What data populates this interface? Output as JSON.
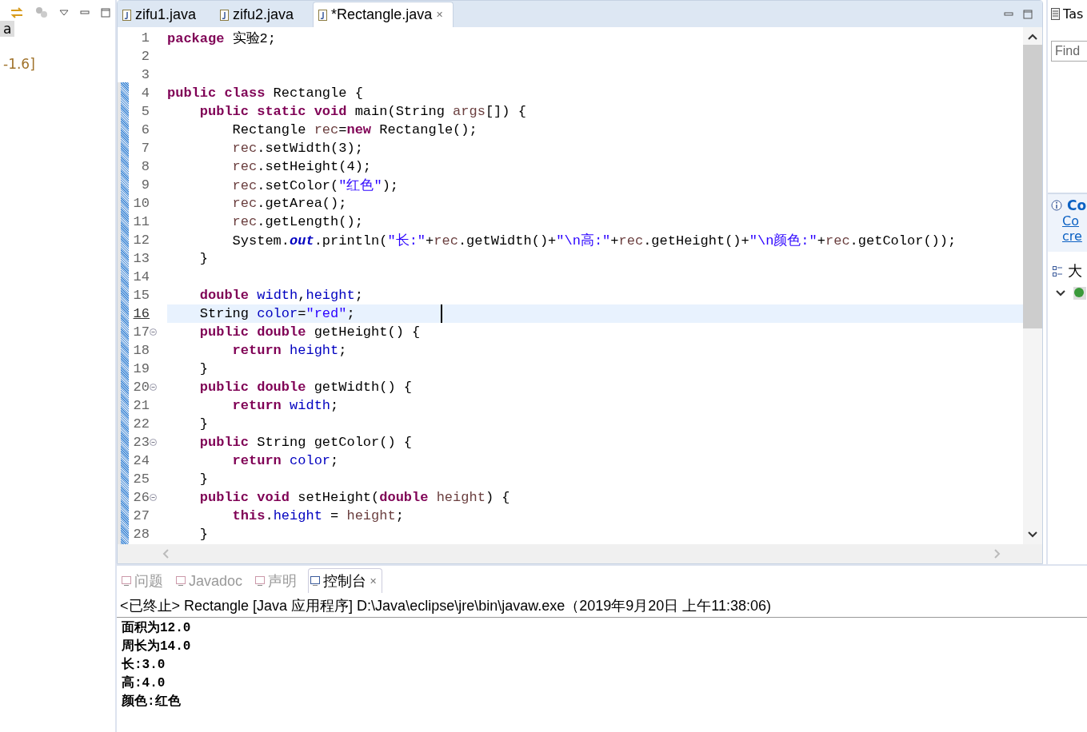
{
  "left_panel": {
    "tree_items": [
      {
        "label": "a",
        "selected": true
      },
      {
        "label": "-1.6]",
        "selected": false
      }
    ]
  },
  "editor": {
    "tabs": [
      {
        "label": "zifu1.java",
        "selected": false
      },
      {
        "label": "zifu2.java",
        "selected": false
      },
      {
        "label": "*Rectangle.java",
        "selected": true,
        "close": "✕"
      }
    ],
    "lines": [
      {
        "number": "1",
        "foldable": false,
        "current": false,
        "tokens": [
          {
            "kind": "kw",
            "text": "package"
          },
          {
            "kind": "plain",
            "text": " 实验2;"
          }
        ]
      },
      {
        "number": "2",
        "foldable": false,
        "current": false
      },
      {
        "number": "3",
        "foldable": false,
        "current": false
      },
      {
        "number": "4",
        "foldable": false,
        "current": false,
        "tokens": [
          {
            "kind": "kw",
            "text": "public class"
          },
          {
            "kind": "plain",
            "text": " Rectangle {"
          }
        ]
      },
      {
        "number": "5",
        "foldable": false,
        "current": false,
        "tokens": [
          {
            "kind": "kw",
            "text": "    public static void"
          },
          {
            "kind": "plain",
            "text": " main(String "
          },
          {
            "kind": "local",
            "text": "args"
          },
          {
            "kind": "plain",
            "text": "[]) {"
          }
        ]
      },
      {
        "number": "6",
        "foldable": false,
        "current": false,
        "tokens": [
          {
            "kind": "plain",
            "text": "        Rectangle "
          },
          {
            "kind": "local",
            "text": "rec"
          },
          {
            "kind": "plain",
            "text": "="
          },
          {
            "kind": "kw",
            "text": "new"
          },
          {
            "kind": "plain",
            "text": " Rectangle();"
          }
        ]
      },
      {
        "number": "7",
        "foldable": false,
        "current": false,
        "tokens": [
          {
            "kind": "local",
            "text": "        rec"
          },
          {
            "kind": "plain",
            "text": ".setWidth(3);"
          }
        ]
      },
      {
        "number": "8",
        "foldable": false,
        "current": false,
        "tokens": [
          {
            "kind": "local",
            "text": "        rec"
          },
          {
            "kind": "plain",
            "text": ".setHeight(4);"
          }
        ]
      },
      {
        "number": "9",
        "foldable": false,
        "current": false,
        "tokens": [
          {
            "kind": "local",
            "text": "        rec"
          },
          {
            "kind": "plain",
            "text": ".setColor("
          },
          {
            "kind": "str",
            "text": "\"红色\""
          },
          {
            "kind": "plain",
            "text": ");"
          }
        ]
      },
      {
        "number": "10",
        "foldable": false,
        "current": false,
        "tokens": [
          {
            "kind": "local",
            "text": "        rec"
          },
          {
            "kind": "plain",
            "text": ".getArea();"
          }
        ]
      },
      {
        "number": "11",
        "foldable": false,
        "current": false,
        "tokens": [
          {
            "kind": "local",
            "text": "        rec"
          },
          {
            "kind": "plain",
            "text": ".getLength();"
          }
        ]
      },
      {
        "number": "12",
        "foldable": false,
        "current": false,
        "tokens": [
          {
            "kind": "plain",
            "text": "        System."
          },
          {
            "kind": "static",
            "text": "out"
          },
          {
            "kind": "plain",
            "text": ".println("
          },
          {
            "kind": "str",
            "text": "\"长:\""
          },
          {
            "kind": "plain",
            "text": "+"
          },
          {
            "kind": "local",
            "text": "rec"
          },
          {
            "kind": "plain",
            "text": ".getWidth()+"
          },
          {
            "kind": "str",
            "text": "\"\\n高:\""
          },
          {
            "kind": "plain",
            "text": "+"
          },
          {
            "kind": "local",
            "text": "rec"
          },
          {
            "kind": "plain",
            "text": ".getHeight()+"
          },
          {
            "kind": "str",
            "text": "\"\\n颜色:\""
          },
          {
            "kind": "plain",
            "text": "+"
          },
          {
            "kind": "local",
            "text": "rec"
          },
          {
            "kind": "plain",
            "text": ".getColor());"
          }
        ]
      },
      {
        "number": "13",
        "foldable": false,
        "current": false,
        "tokens": [
          {
            "kind": "plain",
            "text": "    }"
          }
        ]
      },
      {
        "number": "14",
        "foldable": false,
        "current": false
      },
      {
        "number": "15",
        "foldable": false,
        "current": false,
        "tokens": [
          {
            "kind": "kw",
            "text": "    double"
          },
          {
            "kind": "field",
            "text": " width"
          },
          {
            "kind": "plain",
            "text": ","
          },
          {
            "kind": "field",
            "text": "height"
          },
          {
            "kind": "plain",
            "text": ";"
          }
        ]
      },
      {
        "number": "16",
        "foldable": false,
        "current": true,
        "tokens": [
          {
            "kind": "plain",
            "text": "    String "
          },
          {
            "kind": "field",
            "text": "color"
          },
          {
            "kind": "plain",
            "text": "="
          },
          {
            "kind": "str",
            "text": "\"red\""
          },
          {
            "kind": "plain",
            "text": ";"
          }
        ]
      },
      {
        "number": "17",
        "foldable": true,
        "current": false,
        "tokens": [
          {
            "kind": "kw",
            "text": "    public double"
          },
          {
            "kind": "plain",
            "text": " getHeight() {"
          }
        ]
      },
      {
        "number": "18",
        "foldable": false,
        "current": false,
        "tokens": [
          {
            "kind": "kw",
            "text": "        return"
          },
          {
            "kind": "field",
            "text": " height"
          },
          {
            "kind": "plain",
            "text": ";"
          }
        ]
      },
      {
        "number": "19",
        "foldable": false,
        "current": false,
        "tokens": [
          {
            "kind": "plain",
            "text": "    }"
          }
        ]
      },
      {
        "number": "20",
        "foldable": true,
        "current": false,
        "tokens": [
          {
            "kind": "kw",
            "text": "    public double"
          },
          {
            "kind": "plain",
            "text": " getWidth() {"
          }
        ]
      },
      {
        "number": "21",
        "foldable": false,
        "current": false,
        "tokens": [
          {
            "kind": "kw",
            "text": "        return"
          },
          {
            "kind": "field",
            "text": " width"
          },
          {
            "kind": "plain",
            "text": ";"
          }
        ]
      },
      {
        "number": "22",
        "foldable": false,
        "current": false,
        "tokens": [
          {
            "kind": "plain",
            "text": "    }"
          }
        ]
      },
      {
        "number": "23",
        "foldable": true,
        "current": false,
        "tokens": [
          {
            "kind": "kw",
            "text": "    public"
          },
          {
            "kind": "plain",
            "text": " String getColor() {"
          }
        ]
      },
      {
        "number": "24",
        "foldable": false,
        "current": false,
        "tokens": [
          {
            "kind": "kw",
            "text": "        return"
          },
          {
            "kind": "field",
            "text": " color"
          },
          {
            "kind": "plain",
            "text": ";"
          }
        ]
      },
      {
        "number": "25",
        "foldable": false,
        "current": false,
        "tokens": [
          {
            "kind": "plain",
            "text": "    }"
          }
        ]
      },
      {
        "number": "26",
        "foldable": true,
        "current": false,
        "tokens": [
          {
            "kind": "kw",
            "text": "    public void"
          },
          {
            "kind": "plain",
            "text": " setHeight("
          },
          {
            "kind": "kw",
            "text": "double"
          },
          {
            "kind": "local",
            "text": " height"
          },
          {
            "kind": "plain",
            "text": ") {"
          }
        ]
      },
      {
        "number": "27",
        "foldable": false,
        "current": false,
        "tokens": [
          {
            "kind": "kw",
            "text": "        this"
          },
          {
            "kind": "plain",
            "text": "."
          },
          {
            "kind": "field",
            "text": "height"
          },
          {
            "kind": "plain",
            "text": " = "
          },
          {
            "kind": "local",
            "text": "height"
          },
          {
            "kind": "plain",
            "text": ";"
          }
        ]
      },
      {
        "number": "28",
        "foldable": false,
        "current": false,
        "tokens": [
          {
            "kind": "plain",
            "text": "    }"
          }
        ]
      }
    ]
  },
  "right_panel": {
    "task_tab": "Tas",
    "find_field": {
      "placeholder": "Find"
    },
    "info": {
      "title": "Co",
      "links": [
        "Co",
        "cre"
      ]
    },
    "outline_tab": "大"
  },
  "console": {
    "tabs": [
      {
        "label": "问题",
        "selected": false
      },
      {
        "label": "Javadoc",
        "selected": false
      },
      {
        "label": "声明",
        "selected": false
      },
      {
        "label": "控制台",
        "selected": true,
        "close": "✕"
      }
    ],
    "header": "<已终止> Rectangle [Java 应用程序] D:\\Java\\eclipse\\jre\\bin\\javaw.exe（2019年9月20日 上午11:38:06)",
    "output": [
      "面积为12.0",
      "周长为14.0",
      "长:3.0",
      "高:4.0",
      "颜色:红色"
    ]
  }
}
